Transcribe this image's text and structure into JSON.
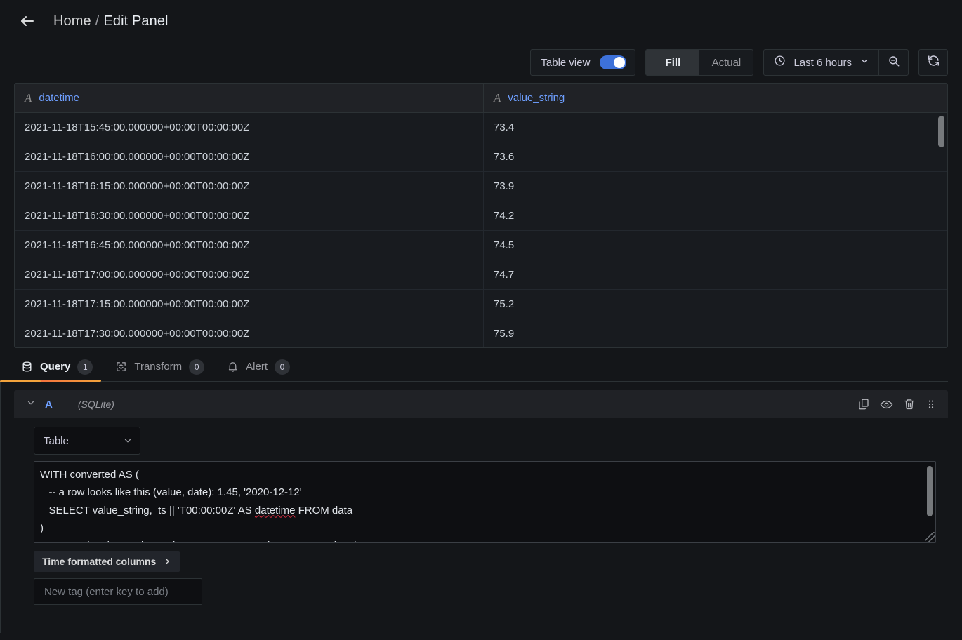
{
  "header": {
    "back_icon": "arrow-left-icon",
    "breadcrumb_home": "Home",
    "breadcrumb_separator": "/",
    "breadcrumb_current": "Edit Panel"
  },
  "toolbar": {
    "table_view_label": "Table view",
    "table_view_enabled": true,
    "toggle_color": "#3d71d9",
    "segmented": {
      "options": [
        "Fill",
        "Actual"
      ],
      "selected": "Fill"
    },
    "time_picker": {
      "icon": "clock-icon",
      "value": "Last 6 hours",
      "chevron": "chevron-down-icon"
    },
    "zoom_out_icon": "zoom-out-icon",
    "refresh_icon": "refresh-icon"
  },
  "table": {
    "columns": [
      {
        "name": "datetime",
        "type_icon": "string-type-icon",
        "type_glyph": "A"
      },
      {
        "name": "value_string",
        "type_icon": "string-type-icon",
        "type_glyph": "A"
      }
    ],
    "rows": [
      {
        "datetime": "2021-11-18T15:45:00.000000+00:00T00:00:00Z",
        "value_string": "73.4"
      },
      {
        "datetime": "2021-11-18T16:00:00.000000+00:00T00:00:00Z",
        "value_string": "73.6"
      },
      {
        "datetime": "2021-11-18T16:15:00.000000+00:00T00:00:00Z",
        "value_string": "73.9"
      },
      {
        "datetime": "2021-11-18T16:30:00.000000+00:00T00:00:00Z",
        "value_string": "74.2"
      },
      {
        "datetime": "2021-11-18T16:45:00.000000+00:00T00:00:00Z",
        "value_string": "74.5"
      },
      {
        "datetime": "2021-11-18T17:00:00.000000+00:00T00:00:00Z",
        "value_string": "74.7"
      },
      {
        "datetime": "2021-11-18T17:15:00.000000+00:00T00:00:00Z",
        "value_string": "75.2"
      },
      {
        "datetime": "2021-11-18T17:30:00.000000+00:00T00:00:00Z",
        "value_string": "75.9"
      }
    ]
  },
  "tabs": [
    {
      "label": "Query",
      "count": "1",
      "icon": "database-icon",
      "active": true
    },
    {
      "label": "Transform",
      "count": "0",
      "icon": "transform-icon",
      "active": false
    },
    {
      "label": "Alert",
      "count": "0",
      "icon": "bell-icon",
      "active": false
    }
  ],
  "query": {
    "collapse_icon": "chevron-down-icon",
    "ref_id": "A",
    "datasource": "(SQLite)",
    "actions": [
      {
        "name": "duplicate-query-icon"
      },
      {
        "name": "hide-query-icon"
      },
      {
        "name": "remove-query-icon"
      },
      {
        "name": "drag-handle-icon"
      }
    ],
    "format_select": {
      "value": "Table",
      "chevron": "chevron-down-icon"
    },
    "sql_lines": [
      [
        {
          "t": "WITH converted AS ("
        }
      ],
      [
        {
          "t": "   -- a row looks like this (value, date): 1.45, '2020-12-12'"
        }
      ],
      [
        {
          "t": "   SELECT value_string,  ts || 'T00:00:00Z' AS "
        },
        {
          "t": "datetime",
          "spell": true
        },
        {
          "t": " FROM data"
        }
      ],
      [
        {
          "t": ")"
        }
      ],
      [
        {
          "t": "SELECT "
        },
        {
          "t": "datetime",
          "spell": true
        },
        {
          "t": ", value_string FROM converted ORDER BY "
        },
        {
          "t": "datetime",
          "spell": true
        },
        {
          "t": " ASC"
        }
      ]
    ],
    "time_formatted_columns_label": "Time formatted columns",
    "time_formatted_columns_chevron": "chevron-right-icon",
    "tag_placeholder": "New tag (enter key to add)"
  },
  "colors": {
    "page_bg": "#141619",
    "panel_bg": "#181b1f",
    "accent_orange": "#f2a33c",
    "link_blue": "#6e9fff",
    "toggle_blue": "#3d71d9",
    "spellcheck_red": "#e02f44"
  }
}
